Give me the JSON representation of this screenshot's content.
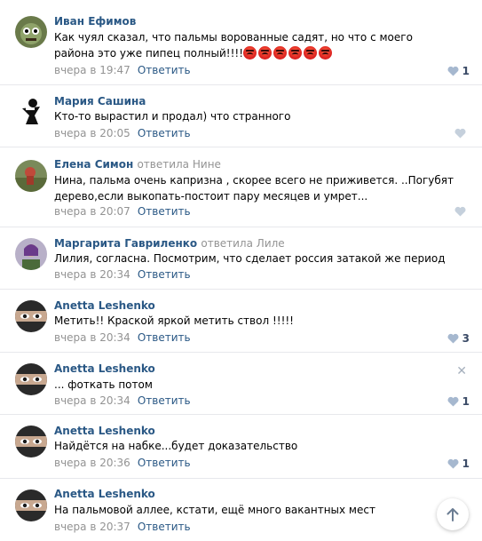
{
  "comments": [
    {
      "author": "Иван Ефимов",
      "reply_to": "",
      "text": "Как чуял сказал, что пальмы ворованные садят, но что с моего района это уже пипец полный!!!!",
      "emoji_count": 6,
      "date": "вчера в 19:47",
      "reply_label": "Ответить",
      "likes": "1"
    },
    {
      "author": "Мария Сашина",
      "reply_to": "",
      "text": "Кто-то вырастил и продал) что странного",
      "date": "вчера в 20:05",
      "reply_label": "Ответить",
      "likes": ""
    },
    {
      "author": "Елена Симон",
      "reply_to_prefix": "ответила",
      "reply_to": "Нине",
      "text": "Нина, пальма очень капризна , скорее всего не приживется. ..Погубят дерево,если выкопать-постоит пару месяцев и умрет...",
      "date": "вчера в 20:07",
      "reply_label": "Ответить",
      "likes": ""
    },
    {
      "author": "Маргарита Гавриленко",
      "reply_to_prefix": "ответила",
      "reply_to": "Лиле",
      "text": "Лилия, согласна. Посмотрим, что сделает россия затакой же период",
      "date": "вчера в 20:34",
      "reply_label": "Ответить",
      "likes": ""
    },
    {
      "author": "Anetta Leshenko",
      "reply_to": "",
      "text": "Метить!! Краской яркой метить ствол !!!!!",
      "date": "вчера в 20:34",
      "reply_label": "Ответить",
      "likes": "3"
    },
    {
      "author": "Anetta Leshenko",
      "reply_to": "",
      "text": "... фоткать потом",
      "date": "вчера в 20:34",
      "reply_label": "Ответить",
      "likes": "1"
    },
    {
      "author": "Anetta Leshenko",
      "reply_to": "",
      "text": "Найдётся на набке...будет доказательство",
      "date": "вчера в 20:36",
      "reply_label": "Ответить",
      "likes": "1"
    },
    {
      "author": "Anetta Leshenko",
      "reply_to": "",
      "text": "На пальмовой аллее, кстати, ещё много вакантных мест",
      "date": "вчера в 20:37",
      "reply_label": "Ответить",
      "likes": ""
    }
  ],
  "icons": {
    "like": "heart-icon",
    "close": "close-icon",
    "scroll_top": "arrow-up-icon",
    "angry_emoji": "angry-face-emoji-icon"
  },
  "colors": {
    "link": "#2a5885",
    "muted": "#939393",
    "like": "#3a4a66",
    "divider": "#e7e8ec"
  }
}
